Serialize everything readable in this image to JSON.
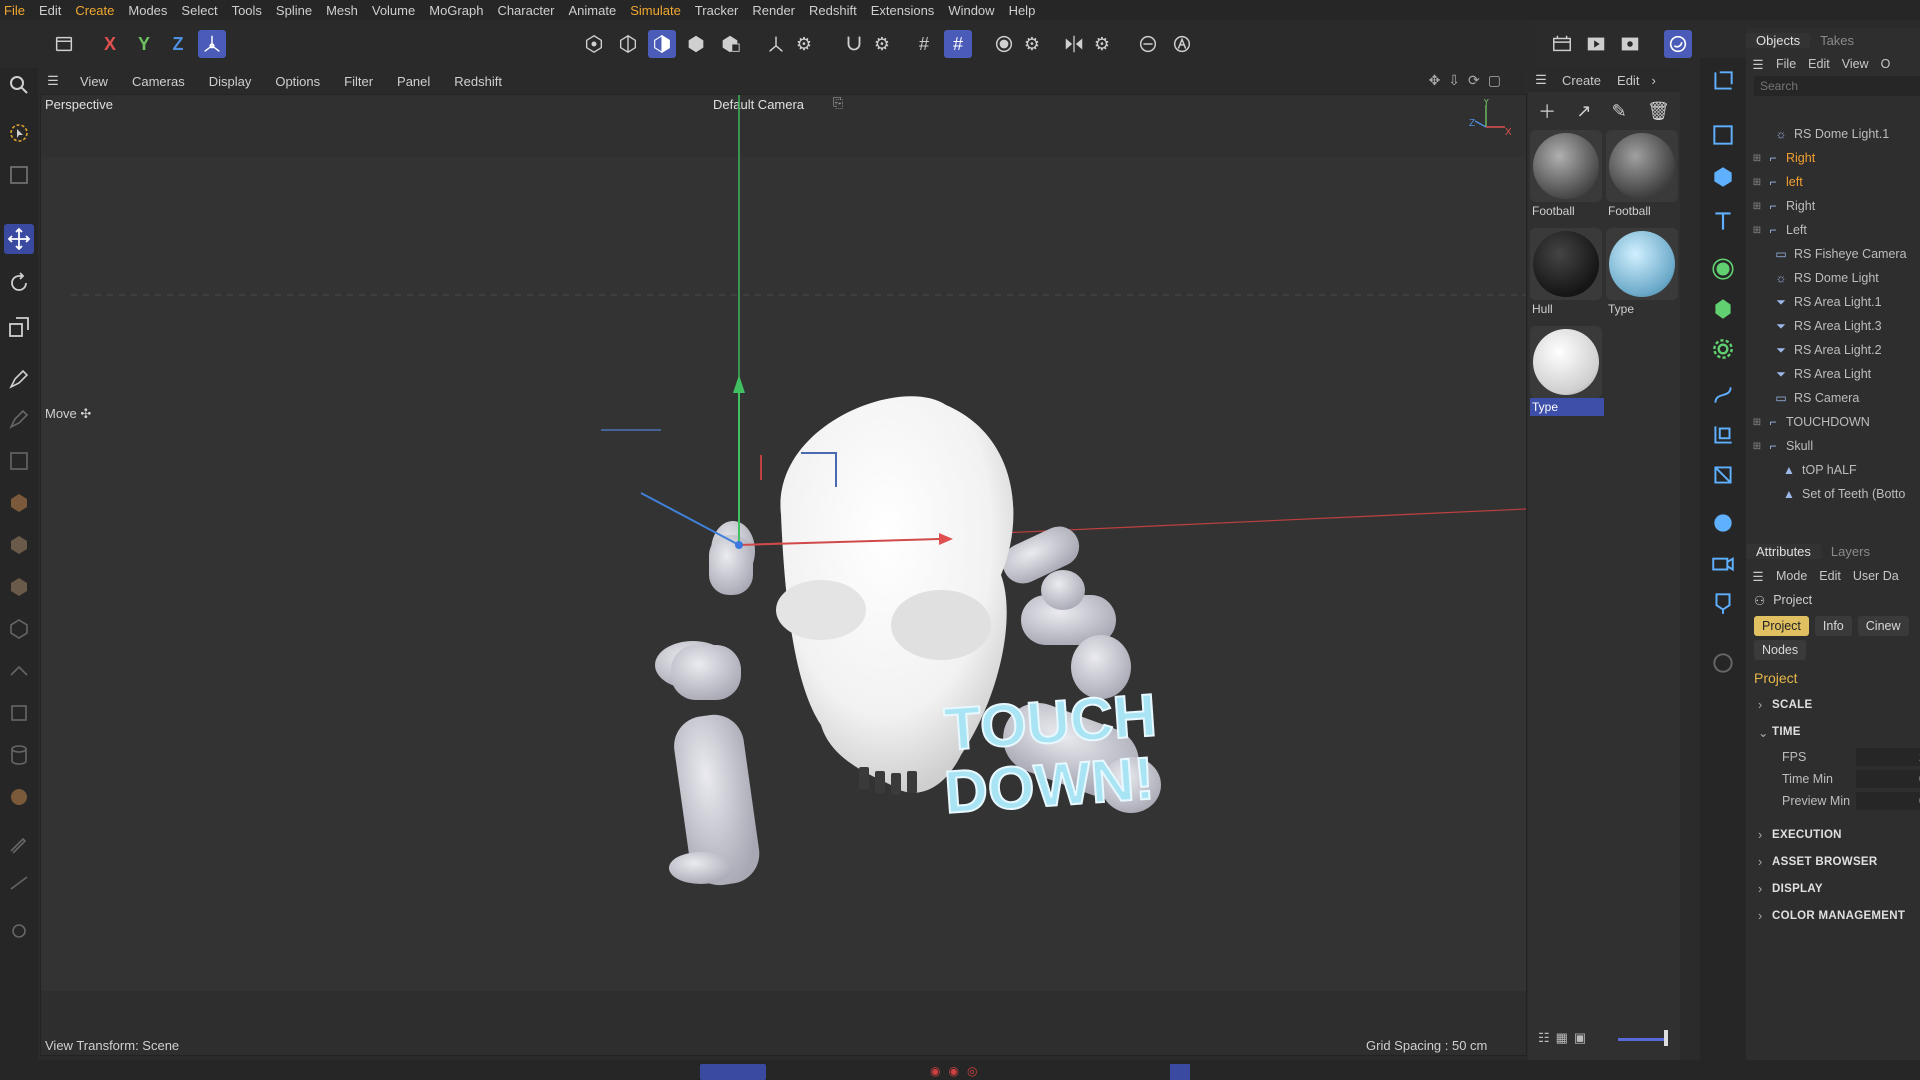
{
  "menubar": [
    "File",
    "Edit",
    "Create",
    "Modes",
    "Select",
    "Tools",
    "Spline",
    "Mesh",
    "Volume",
    "MoGraph",
    "Character",
    "Animate",
    "Simulate",
    "Tracker",
    "Render",
    "Redshift",
    "Extensions",
    "Window",
    "Help"
  ],
  "menubar_highlight": [
    "File",
    "Create",
    "Simulate"
  ],
  "toolbar": {
    "axis_x": "X",
    "axis_y": "Y",
    "axis_z": "Z"
  },
  "viewport": {
    "menu": [
      "View",
      "Cameras",
      "Display",
      "Options",
      "Filter",
      "Panel",
      "Redshift"
    ],
    "mode_label": "Perspective",
    "camera_label": "Default Camera",
    "tool_label": "Move",
    "view_transform": "View Transform: Scene",
    "grid_spacing": "Grid Spacing : 50 cm",
    "axis_gizmo_labels": {
      "y": "Y",
      "z": "Z",
      "x": "X"
    },
    "text_object": [
      "TOUCH",
      "DOWN!"
    ]
  },
  "materials": {
    "menu": [
      "Create",
      "Edit"
    ],
    "items": [
      {
        "label": "Football",
        "color": "#6a6a6a"
      },
      {
        "label": "Football",
        "color": "#5a5a5a"
      },
      {
        "label": "Hull",
        "color": "#1e1e1e"
      },
      {
        "label": "Type",
        "color": "#7fb8d8"
      },
      {
        "label": "Type",
        "color": "#d8d8d8",
        "selected": true
      }
    ]
  },
  "objects": {
    "tabs": [
      "Objects",
      "Takes"
    ],
    "menu": [
      "File",
      "Edit",
      "View",
      "O"
    ],
    "search_placeholder": "Search",
    "rows": [
      {
        "label": "RS Dome Light.1",
        "icon": "light-icon",
        "indent": 1,
        "red": false,
        "expand": ""
      },
      {
        "label": "Right",
        "icon": "null-icon",
        "indent": 0,
        "red": true,
        "expand": "+"
      },
      {
        "label": "left",
        "icon": "null-icon",
        "indent": 0,
        "red": true,
        "expand": "+"
      },
      {
        "label": "Right",
        "icon": "null-icon",
        "indent": 0,
        "red": false,
        "expand": "+"
      },
      {
        "label": "Left",
        "icon": "null-icon",
        "indent": 0,
        "red": false,
        "expand": "+"
      },
      {
        "label": "RS Fisheye Camera",
        "icon": "camera-icon",
        "indent": 1,
        "red": false,
        "expand": ""
      },
      {
        "label": "RS Dome Light",
        "icon": "light-icon",
        "indent": 1,
        "red": false,
        "expand": ""
      },
      {
        "label": "RS Area Light.1",
        "icon": "area-light-icon",
        "indent": 1,
        "red": false,
        "expand": ""
      },
      {
        "label": "RS Area Light.3",
        "icon": "area-light-icon",
        "indent": 1,
        "red": false,
        "expand": ""
      },
      {
        "label": "RS Area Light.2",
        "icon": "area-light-icon",
        "indent": 1,
        "red": false,
        "expand": ""
      },
      {
        "label": "RS Area Light",
        "icon": "area-light-icon",
        "indent": 1,
        "red": false,
        "expand": ""
      },
      {
        "label": "RS Camera",
        "icon": "camera-icon",
        "indent": 1,
        "red": false,
        "expand": ""
      },
      {
        "label": "TOUCHDOWN",
        "icon": "null-icon",
        "indent": 0,
        "red": false,
        "expand": "+"
      },
      {
        "label": "Skull",
        "icon": "null-icon",
        "indent": 0,
        "red": false,
        "expand": "−"
      },
      {
        "label": "tOP hALF",
        "icon": "mesh-icon",
        "indent": 2,
        "red": false,
        "expand": ""
      },
      {
        "label": "Set of Teeth (Botto",
        "icon": "mesh-icon",
        "indent": 2,
        "red": false,
        "expand": ""
      }
    ]
  },
  "attributes": {
    "tabs": [
      "Attributes",
      "Layers"
    ],
    "menu": [
      "Mode",
      "Edit",
      "User Da"
    ],
    "header": "Project",
    "chips": [
      "Project",
      "Info",
      "Cinew"
    ],
    "chip_nodes": "Nodes",
    "title": "Project",
    "sections": [
      "SCALE",
      "TIME",
      "EXECUTION",
      "ASSET BROWSER",
      "DISPLAY",
      "COLOR MANAGEMENT"
    ],
    "time_fields": [
      {
        "label": "FPS",
        "value": "2"
      },
      {
        "label": "Time Min",
        "value": "0"
      },
      {
        "label": "Preview Min",
        "value": "0"
      }
    ]
  }
}
